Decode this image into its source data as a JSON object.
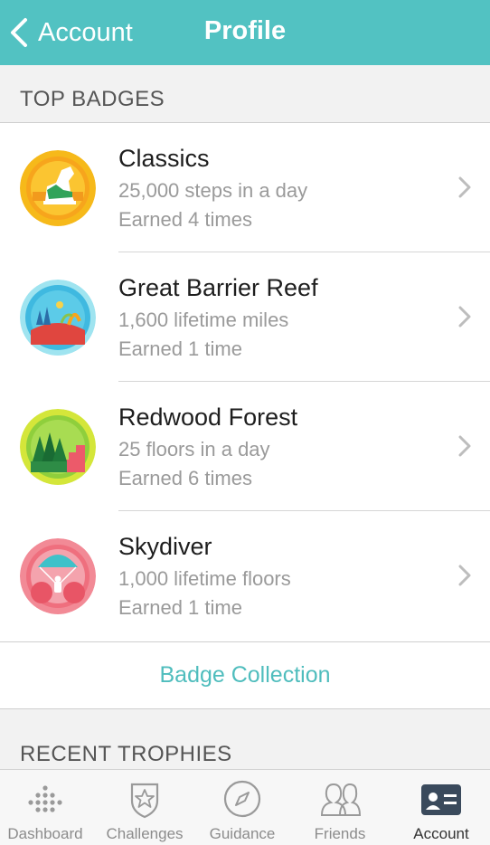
{
  "header": {
    "back_label": "Account",
    "title": "Profile",
    "bg_color": "#52c2c2"
  },
  "top_badges": {
    "section_title": "TOP BADGES",
    "items": [
      {
        "name": "Classics",
        "description": "25,000 steps in a day",
        "earned": "Earned 4 times",
        "icon": "sneaker-badge-icon"
      },
      {
        "name": "Great Barrier Reef",
        "description": "1,600 lifetime miles",
        "earned": "Earned 1 time",
        "icon": "reef-badge-icon"
      },
      {
        "name": "Redwood Forest",
        "description": "25 floors in a day",
        "earned": "Earned 6 times",
        "icon": "forest-badge-icon"
      },
      {
        "name": "Skydiver",
        "description": "1,000 lifetime floors",
        "earned": "Earned 1 time",
        "icon": "parachute-badge-icon"
      }
    ],
    "collection_label": "Badge Collection"
  },
  "recent_trophies": {
    "section_title": "RECENT TROPHIES"
  },
  "tabbar": {
    "tabs": [
      {
        "label": "Dashboard",
        "icon": "dots-grid-icon",
        "active": false
      },
      {
        "label": "Challenges",
        "icon": "star-shield-icon",
        "active": false
      },
      {
        "label": "Guidance",
        "icon": "compass-icon",
        "active": false
      },
      {
        "label": "Friends",
        "icon": "people-icon",
        "active": false
      },
      {
        "label": "Account",
        "icon": "id-card-icon",
        "active": true
      }
    ]
  },
  "colors": {
    "accent": "#4fbdbd",
    "secondary_text": "#9a9a9a"
  }
}
